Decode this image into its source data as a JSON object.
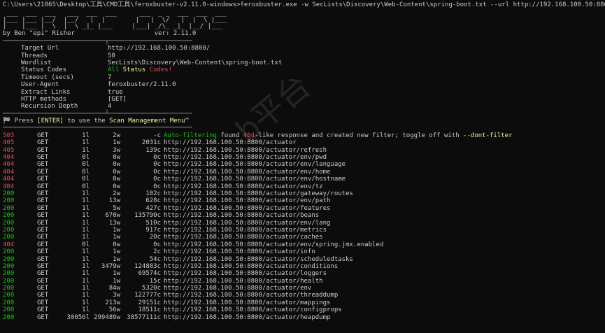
{
  "command_line": "C:\\Users\\21865\\Desktop\\工具\\CMD工具\\feroxbuster-v2.11.0-windows>feroxbuster.exe -w SecLists\\Discovery\\Web-Content\\spring-boot.txt --url http://192.168.100.50:8800/",
  "banner_ascii": " ___  ___  ___   ___  ___  ___      ___  _ _  ___  ___  ___\n|___ |___ |__/  |__/   |  |        |   |  \\/   |  |  \\ |___\n|    |___ |  \\  |  \\ _|_ |___     |___| _/\\_ _|_ |__/ |___",
  "byline_author": "by Ben \"epi\" Risher",
  "byline_version": "ver: 2.11.0",
  "separator_top": "───────────────────────────┬──────────────────────",
  "separator_mid": "───────────────────────────┴──────────────────────",
  "config": [
    {
      "icon": "🎯",
      "key": "Target Url",
      "value": "http://192.168.100.50:8800/"
    },
    {
      "icon": "🚀",
      "key": "Threads",
      "value": "50"
    },
    {
      "icon": "📖",
      "key": "Wordlist",
      "value": "SecLists\\Discovery\\Web-Content\\spring-boot.txt"
    },
    {
      "icon": "👌",
      "key": "Status Codes",
      "value_parts": [
        "All",
        " Status",
        " Codes!"
      ]
    },
    {
      "icon": "💥",
      "key": "Timeout (secs)",
      "value": "7"
    },
    {
      "icon": "🦡",
      "key": "User-Agent",
      "value": "feroxbuster/2.11.0"
    },
    {
      "icon": "🔎",
      "key": "Extract Links",
      "value": "true"
    },
    {
      "icon": "🏁",
      "key": "HTTP methods",
      "value": "[GET]"
    },
    {
      "icon": "🔃",
      "key": "Recursion Depth",
      "value": "4"
    }
  ],
  "press_line": {
    "icon": "🏁",
    "prefix": "Press ",
    "key": "[ENTER]",
    "middle": " to use the ",
    "menu": "Scan Management Menu",
    "suffix": "™"
  },
  "separator_bottom": "──────────────────────────────────────────────────",
  "autofilter": {
    "status": "503",
    "method": "GET",
    "lines": "1l",
    "words": "2w",
    "chars": "-c",
    "label": "Auto-filtering",
    "text1": " found ",
    "code": "404",
    "text2": "-like response and created new filter; toggle off with ",
    "flag": "--dont-filter"
  },
  "results": [
    {
      "status": "405",
      "method": "GET",
      "lines": "1l",
      "words": "1w",
      "chars": "2031c",
      "url": "http://192.168.100.50:8800/actuator"
    },
    {
      "status": "405",
      "method": "GET",
      "lines": "1l",
      "words": "3w",
      "chars": "139c",
      "url": "http://192.168.100.50:8800/actuator/refresh"
    },
    {
      "status": "404",
      "method": "GET",
      "lines": "0l",
      "words": "0w",
      "chars": "0c",
      "url": "http://192.168.100.50:8800/actuator/env/pwd"
    },
    {
      "status": "404",
      "method": "GET",
      "lines": "0l",
      "words": "0w",
      "chars": "0c",
      "url": "http://192.168.100.50:8800/actuator/env/language"
    },
    {
      "status": "404",
      "method": "GET",
      "lines": "0l",
      "words": "0w",
      "chars": "0c",
      "url": "http://192.168.100.50:8800/actuator/env/home"
    },
    {
      "status": "404",
      "method": "GET",
      "lines": "0l",
      "words": "0w",
      "chars": "0c",
      "url": "http://192.168.100.50:8800/actuator/env/hostname"
    },
    {
      "status": "404",
      "method": "GET",
      "lines": "0l",
      "words": "0w",
      "chars": "0c",
      "url": "http://192.168.100.50:8800/actuator/env/tz"
    },
    {
      "status": "200",
      "method": "GET",
      "lines": "1l",
      "words": "2w",
      "chars": "102c",
      "url": "http://192.168.100.50:8800/actuator/gateway/routes"
    },
    {
      "status": "200",
      "method": "GET",
      "lines": "1l",
      "words": "13w",
      "chars": "628c",
      "url": "http://192.168.100.50:8800/actuator/env/path"
    },
    {
      "status": "200",
      "method": "GET",
      "lines": "1l",
      "words": "5w",
      "chars": "427c",
      "url": "http://192.168.100.50:8800/actuator/features"
    },
    {
      "status": "200",
      "method": "GET",
      "lines": "1l",
      "words": "670w",
      "chars": "135790c",
      "url": "http://192.168.100.50:8800/actuator/beans"
    },
    {
      "status": "200",
      "method": "GET",
      "lines": "1l",
      "words": "13w",
      "chars": "510c",
      "url": "http://192.168.100.50:8800/actuator/env/lang"
    },
    {
      "status": "200",
      "method": "GET",
      "lines": "1l",
      "words": "1w",
      "chars": "917c",
      "url": "http://192.168.100.50:8800/actuator/metrics"
    },
    {
      "status": "200",
      "method": "GET",
      "lines": "1l",
      "words": "1w",
      "chars": "20c",
      "url": "http://192.168.100.50:8800/actuator/caches"
    },
    {
      "status": "404",
      "method": "GET",
      "lines": "0l",
      "words": "0w",
      "chars": "0c",
      "url": "http://192.168.100.50:8800/actuator/env/spring.jmx.enabled"
    },
    {
      "status": "200",
      "method": "GET",
      "lines": "1l",
      "words": "1w",
      "chars": "2c",
      "url": "http://192.168.100.50:8800/actuator/info"
    },
    {
      "status": "200",
      "method": "GET",
      "lines": "1l",
      "words": "1w",
      "chars": "54c",
      "url": "http://192.168.100.50:8800/actuator/scheduledtasks"
    },
    {
      "status": "200",
      "method": "GET",
      "lines": "1l",
      "words": "3479w",
      "chars": "124883c",
      "url": "http://192.168.100.50:8800/actuator/conditions"
    },
    {
      "status": "200",
      "method": "GET",
      "lines": "1l",
      "words": "1w",
      "chars": "69574c",
      "url": "http://192.168.100.50:8800/actuator/loggers"
    },
    {
      "status": "200",
      "method": "GET",
      "lines": "1l",
      "words": "1w",
      "chars": "15c",
      "url": "http://192.168.100.50:8800/actuator/health"
    },
    {
      "status": "200",
      "method": "GET",
      "lines": "1l",
      "words": "84w",
      "chars": "5320c",
      "url": "http://192.168.100.50:8800/actuator/env"
    },
    {
      "status": "200",
      "method": "GET",
      "lines": "1l",
      "words": "3w",
      "chars": "122777c",
      "url": "http://192.168.100.50:8800/actuator/threaddump"
    },
    {
      "status": "200",
      "method": "GET",
      "lines": "1l",
      "words": "213w",
      "chars": "29151c",
      "url": "http://192.168.100.50:8800/actuator/mappings"
    },
    {
      "status": "200",
      "method": "GET",
      "lines": "1l",
      "words": "56w",
      "chars": "18511c",
      "url": "http://192.168.100.50:8800/actuator/configprops"
    },
    {
      "status": "200",
      "method": "GET",
      "lines": "30056l",
      "words": "299489w",
      "chars": "38577111c",
      "url": "http://192.168.100.50:8800/actuator/heapdump"
    }
  ],
  "watermark": "b平台",
  "colors": {
    "success": "#16c60c",
    "error": "#e74856",
    "highlight": "#f9f1a5",
    "text": "#cccccc"
  }
}
